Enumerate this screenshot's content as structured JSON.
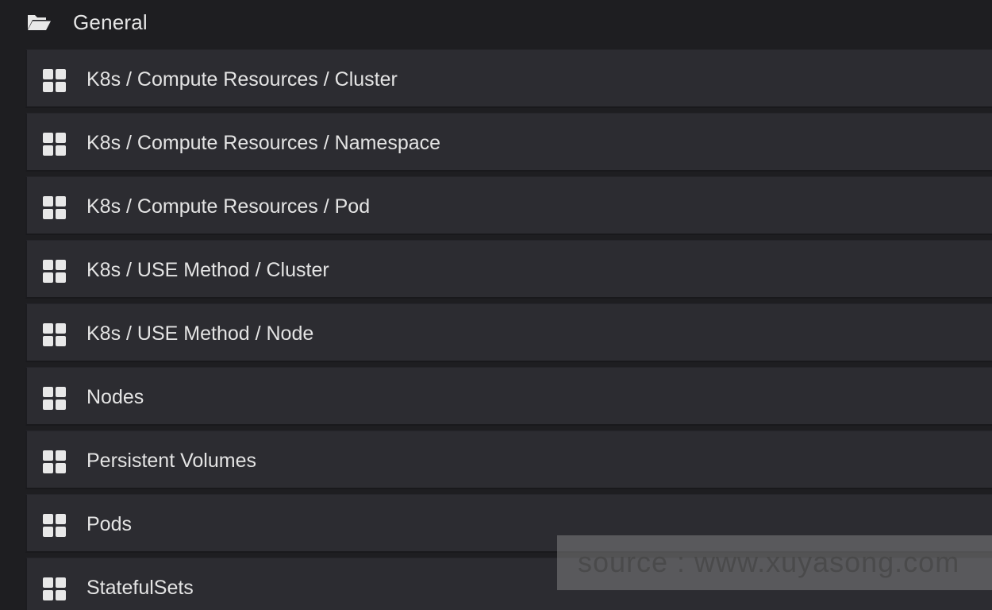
{
  "folder": {
    "icon": "folder-open-icon",
    "title": "General"
  },
  "dashboards": [
    {
      "label": "K8s / Compute Resources / Cluster",
      "icon": "dashboard-grid-icon"
    },
    {
      "label": "K8s / Compute Resources / Namespace",
      "icon": "dashboard-grid-icon"
    },
    {
      "label": "K8s / Compute Resources / Pod",
      "icon": "dashboard-grid-icon"
    },
    {
      "label": "K8s / USE Method / Cluster",
      "icon": "dashboard-grid-icon"
    },
    {
      "label": "K8s / USE Method / Node",
      "icon": "dashboard-grid-icon"
    },
    {
      "label": "Nodes",
      "icon": "dashboard-grid-icon"
    },
    {
      "label": "Persistent Volumes",
      "icon": "dashboard-grid-icon"
    },
    {
      "label": "Pods",
      "icon": "dashboard-grid-icon"
    },
    {
      "label": "StatefulSets",
      "icon": "dashboard-grid-icon"
    }
  ],
  "watermark": {
    "text": "source : www.xuyasong.com"
  },
  "colors": {
    "background": "#1e1e21",
    "row_background": "#2c2c31",
    "text": "#e4e4e4",
    "icon": "#e8e8e8"
  }
}
